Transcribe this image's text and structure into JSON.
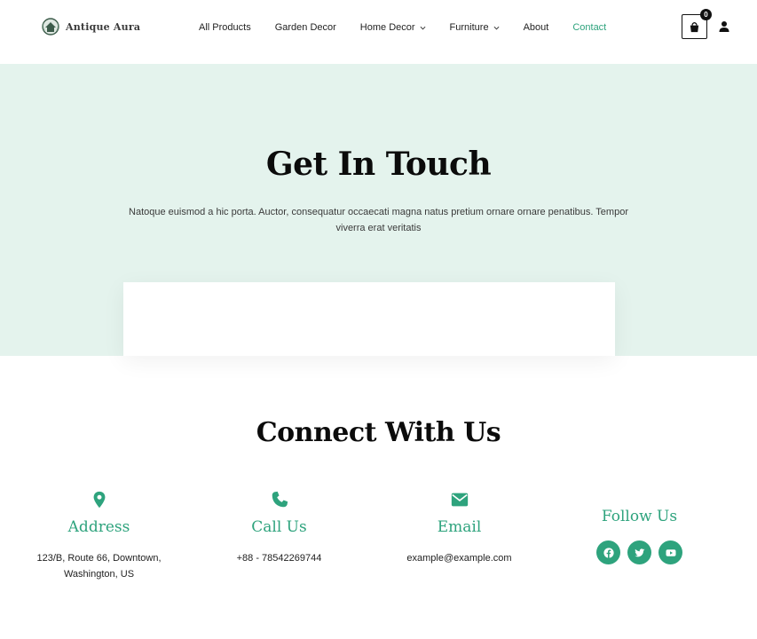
{
  "header": {
    "logo_text": "Antique Aura",
    "nav": [
      {
        "label": "All Products",
        "has_dropdown": false
      },
      {
        "label": "Garden Decor",
        "has_dropdown": false
      },
      {
        "label": "Home Decor",
        "has_dropdown": true
      },
      {
        "label": "Furniture",
        "has_dropdown": true
      },
      {
        "label": "About",
        "has_dropdown": false
      },
      {
        "label": "Contact",
        "has_dropdown": false,
        "active": true
      }
    ],
    "cart_count": "0"
  },
  "hero": {
    "title": "Get In Touch",
    "description": "Natoque euismod a hic porta. Auctor, consequatur occaecati magna natus pretium ornare ornare penatibus. Tempor viverra erat veritatis"
  },
  "connect": {
    "title": "Connect With Us",
    "address": {
      "title": "Address",
      "text": "123/B, Route 66, Downtown, Washington, US",
      "icon": "map-pin-icon"
    },
    "call": {
      "title": "Call Us",
      "text": "+88 - 78542269744",
      "icon": "phone-icon"
    },
    "email": {
      "title": "Email",
      "text": "example@example.com",
      "icon": "envelope-icon"
    },
    "follow": {
      "title": "Follow Us",
      "icons": [
        "facebook-icon",
        "twitter-icon",
        "youtube-icon"
      ]
    }
  },
  "colors": {
    "accent": "#2ea37d",
    "hero_bg": "#e4f3ed"
  }
}
